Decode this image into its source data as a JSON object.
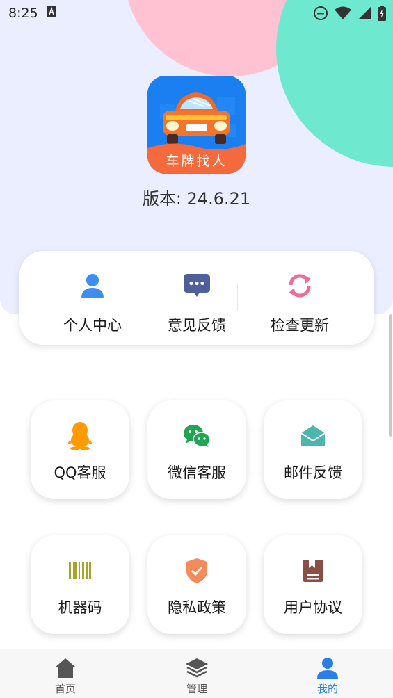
{
  "status_bar": {
    "time": "8:25"
  },
  "app": {
    "logo_text": "车牌找人",
    "version": "版本: 24.6.21"
  },
  "quick_actions": [
    {
      "label": "个人中心",
      "icon": "person-icon"
    },
    {
      "label": "意见反馈",
      "icon": "chat-bubble-icon"
    },
    {
      "label": "检查更新",
      "icon": "refresh-icon"
    }
  ],
  "tiles": [
    {
      "label": "QQ客服",
      "icon": "qq-penguin-icon",
      "color": "#ff9a00"
    },
    {
      "label": "微信客服",
      "icon": "wechat-icon",
      "color": "#22a552"
    },
    {
      "label": "邮件反馈",
      "icon": "mail-open-icon",
      "color": "#4cb5ae"
    },
    {
      "label": "机器码",
      "icon": "barcode-icon",
      "color": "#a6a624"
    },
    {
      "label": "隐私政策",
      "icon": "shield-check-icon",
      "color": "#f58a5a"
    },
    {
      "label": "用户协议",
      "icon": "agreement-book-icon",
      "color": "#8a5048"
    }
  ],
  "bottom_nav": [
    {
      "label": "首页",
      "icon": "home-icon"
    },
    {
      "label": "管理",
      "icon": "layers-icon"
    },
    {
      "label": "我的",
      "icon": "profile-icon",
      "active": true
    }
  ],
  "colors": {
    "hero_bg": "#ebeeff",
    "accent_blue": "#2b7ee6",
    "circle_pink": "#ffc2d2",
    "circle_green": "#6ee8cf"
  }
}
